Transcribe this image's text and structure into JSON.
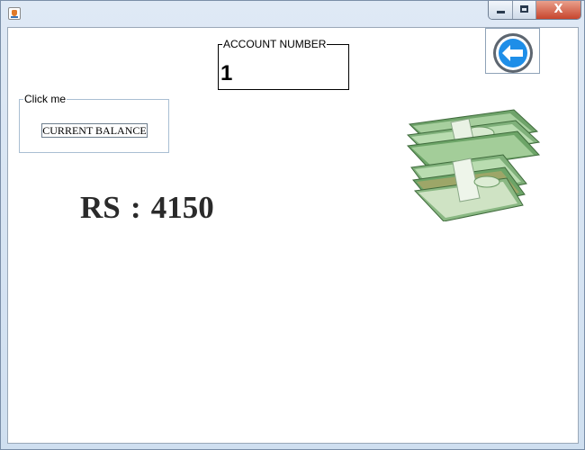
{
  "window": {
    "controls": {
      "close_glyph": "X"
    }
  },
  "account": {
    "label": "ACCOUNT NUMBER",
    "value": "1"
  },
  "click_panel": {
    "label": "Click me",
    "button_label": "CURRENT BALANCE"
  },
  "balance": {
    "prefix": "RS",
    "separator": ":",
    "amount": "4150"
  },
  "icons": {
    "app": "java-app-icon",
    "back": "back-arrow-icon",
    "money": "money-stack-icon"
  },
  "colors": {
    "back_ring": "#5d6670",
    "back_fill": "#1e8ee8",
    "money_green": "#7fb07a",
    "balance_text": "#2a2a2a"
  }
}
